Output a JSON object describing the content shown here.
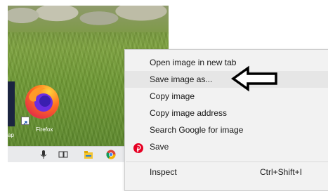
{
  "desktop": {
    "left_label": "ap",
    "firefox_label": "Firefox"
  },
  "taskbar": {
    "icons": [
      "microphone-icon",
      "task-view-icon",
      "file-explorer-icon",
      "chrome-icon",
      "app-icon"
    ]
  },
  "context_menu": {
    "open_new_tab": "Open image in new tab",
    "save_image_as": "Save image as...",
    "copy_image": "Copy image",
    "copy_image_address": "Copy image address",
    "search_google": "Search Google for image",
    "save": "Save",
    "inspect": "Inspect",
    "inspect_shortcut": "Ctrl+Shift+I"
  },
  "colors": {
    "pinterest": "#e60023",
    "firefox_orange": "#ff7a1a",
    "firefox_purple": "#5b2bd6",
    "highlight": "#e6e6e6"
  }
}
